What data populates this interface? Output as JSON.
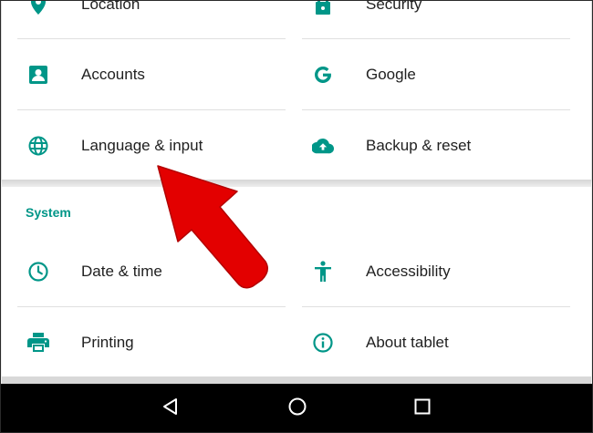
{
  "colors": {
    "accent": "#009688",
    "text": "#212121",
    "arrow": "#e30000",
    "navbar": "#000000"
  },
  "personal_items": [
    {
      "label": "Location",
      "icon": "location-pin-icon"
    },
    {
      "label": "Security",
      "icon": "lock-icon"
    },
    {
      "label": "Accounts",
      "icon": "account-box-icon"
    },
    {
      "label": "Google",
      "icon": "google-g-icon"
    },
    {
      "label": "Language & input",
      "icon": "globe-icon"
    },
    {
      "label": "Backup & reset",
      "icon": "cloud-upload-icon"
    }
  ],
  "system_section": {
    "title": "System",
    "items": [
      {
        "label": "Date & time",
        "icon": "clock-icon"
      },
      {
        "label": "Accessibility",
        "icon": "accessibility-icon"
      },
      {
        "label": "Printing",
        "icon": "printer-icon"
      },
      {
        "label": "About tablet",
        "icon": "info-icon"
      }
    ]
  },
  "navbar": {
    "buttons": [
      "back-icon",
      "home-icon",
      "recents-icon"
    ]
  },
  "annotation": {
    "type": "red-arrow",
    "points_to": "Language & input"
  }
}
